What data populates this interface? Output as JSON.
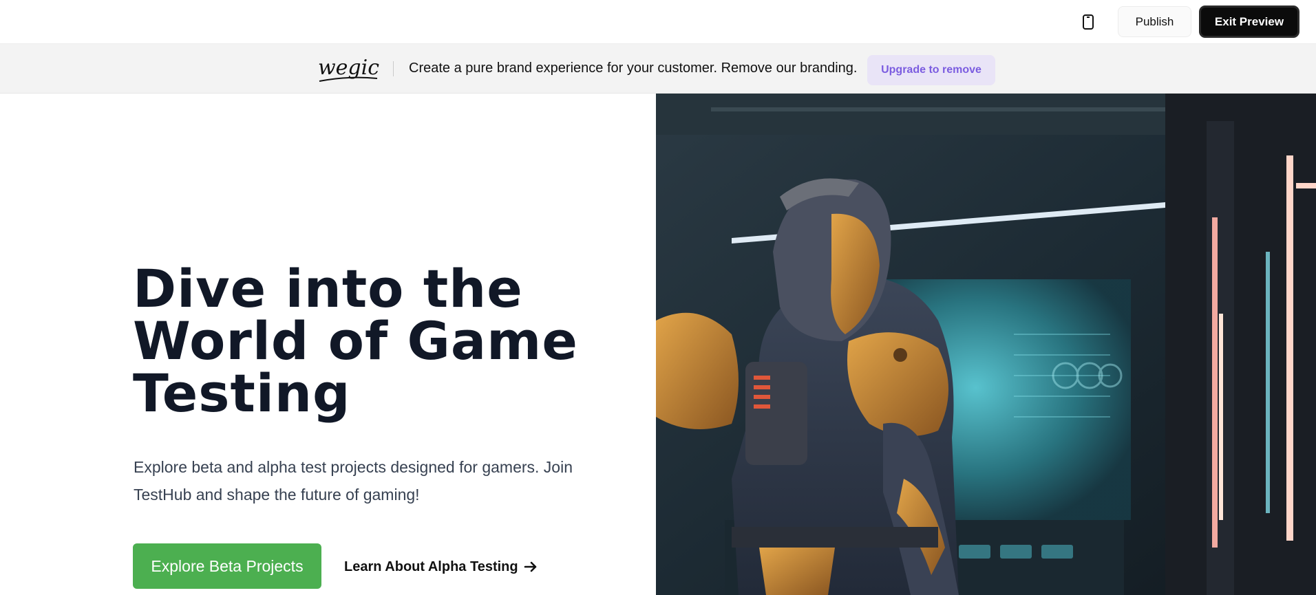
{
  "toolbar": {
    "device_icon": "mobile-phone-icon",
    "publish_label": "Publish",
    "exit_label": "Exit Preview"
  },
  "banner": {
    "logo_text": "wegic",
    "message": "Create a pure brand experience for your customer. Remove our branding.",
    "upgrade_label": "Upgrade to remove"
  },
  "hero": {
    "title_lines": [
      "Dive into the",
      "World of Game",
      "Testing"
    ],
    "subtitle": "Explore beta and alpha test projects designed for gamers. Join TestHub and shape the future of gaming!",
    "primary_cta": "Explore Beta Projects",
    "secondary_cta": "Learn About Alpha Testing",
    "secondary_icon": "arrow-right-icon"
  },
  "colors": {
    "primary_green": "#4caf50",
    "upgrade_purple": "#7b5ce0",
    "upgrade_bg": "#e9e4f7",
    "exit_bg": "#0b0b0b",
    "title_color": "#111827"
  }
}
